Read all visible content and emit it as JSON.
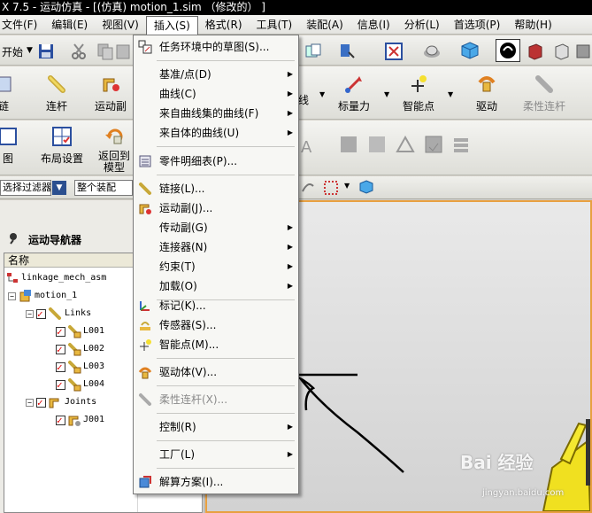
{
  "window": {
    "title": "X 7.5 - 运动仿真 - [(仿真) motion_1.sim （修改的） ]"
  },
  "menubar": {
    "items": [
      "文件(F)",
      "编辑(E)",
      "视图(V)",
      "插入(S)",
      "格式(R)",
      "工具(T)",
      "装配(A)",
      "信息(I)",
      "分析(L)",
      "首选项(P)",
      "帮助(H)"
    ]
  },
  "toolbar1": {
    "start_label": "开始"
  },
  "toolbar2": {
    "buttons": [
      "链",
      "连杆",
      "运动副",
      "线",
      "标量力",
      "智能点",
      "驱动",
      "柔性连杆"
    ]
  },
  "toolbar3": {
    "buttons": [
      "图",
      "布局设置",
      "返回到模型"
    ]
  },
  "toolbar4": {
    "filter_label": "选择过滤器",
    "assembly_label": "整个装配"
  },
  "navigator": {
    "title": "运动导航器",
    "column_header": "名称",
    "tree": [
      {
        "label": "linkage_mech_asm"
      },
      {
        "label": "motion_1"
      },
      {
        "label": "Links"
      },
      {
        "label": "L001"
      },
      {
        "label": "L002"
      },
      {
        "label": "L003"
      },
      {
        "label": "L004"
      },
      {
        "label": "Joints"
      },
      {
        "label": "J001"
      }
    ]
  },
  "insert_menu": {
    "items": [
      {
        "label": "任务环境中的草图(S)...",
        "submenu": false,
        "disabled": false,
        "icon": "sketch-icon"
      },
      {
        "label": "基准/点(D)",
        "submenu": true,
        "disabled": false,
        "icon": ""
      },
      {
        "label": "曲线(C)",
        "submenu": true,
        "disabled": false,
        "icon": ""
      },
      {
        "label": "来自曲线集的曲线(F)",
        "submenu": true,
        "disabled": false,
        "icon": ""
      },
      {
        "label": "来自体的曲线(U)",
        "submenu": true,
        "disabled": false,
        "icon": ""
      },
      {
        "label": "零件明细表(P)...",
        "submenu": false,
        "disabled": false,
        "icon": "parts-list-icon"
      },
      {
        "label": "链接(L)...",
        "submenu": false,
        "disabled": false,
        "icon": "link-icon"
      },
      {
        "label": "运动副(J)...",
        "submenu": false,
        "disabled": false,
        "icon": "joint-icon"
      },
      {
        "label": "传动副(G)",
        "submenu": true,
        "disabled": false,
        "icon": ""
      },
      {
        "label": "连接器(N)",
        "submenu": true,
        "disabled": false,
        "icon": ""
      },
      {
        "label": "约束(T)",
        "submenu": true,
        "disabled": false,
        "icon": ""
      },
      {
        "label": "加载(O)",
        "submenu": true,
        "disabled": false,
        "icon": ""
      },
      {
        "label": "标记(K)...",
        "submenu": false,
        "disabled": false,
        "icon": "marker-icon"
      },
      {
        "label": "传感器(S)...",
        "submenu": false,
        "disabled": false,
        "icon": "sensor-icon"
      },
      {
        "label": "智能点(M)...",
        "submenu": false,
        "disabled": false,
        "icon": "smart-point-icon"
      },
      {
        "label": "驱动体(V)...",
        "submenu": false,
        "disabled": false,
        "icon": "driver-icon"
      },
      {
        "label": "柔性连杆(X)...",
        "submenu": false,
        "disabled": true,
        "icon": "flexible-link-icon"
      },
      {
        "label": "控制(R)",
        "submenu": true,
        "disabled": false,
        "icon": ""
      },
      {
        "label": "工厂(L)",
        "submenu": true,
        "disabled": false,
        "icon": ""
      },
      {
        "label": "解算方案(I)...",
        "submenu": false,
        "disabled": false,
        "icon": "solution-icon"
      }
    ]
  },
  "watermark": {
    "text": "Bai 经验",
    "sub": "jingyan.baidu.com"
  },
  "colors": {
    "accent_border": "#e8a040",
    "menu_active": "#ffffff",
    "check_red": "#dd0000"
  }
}
